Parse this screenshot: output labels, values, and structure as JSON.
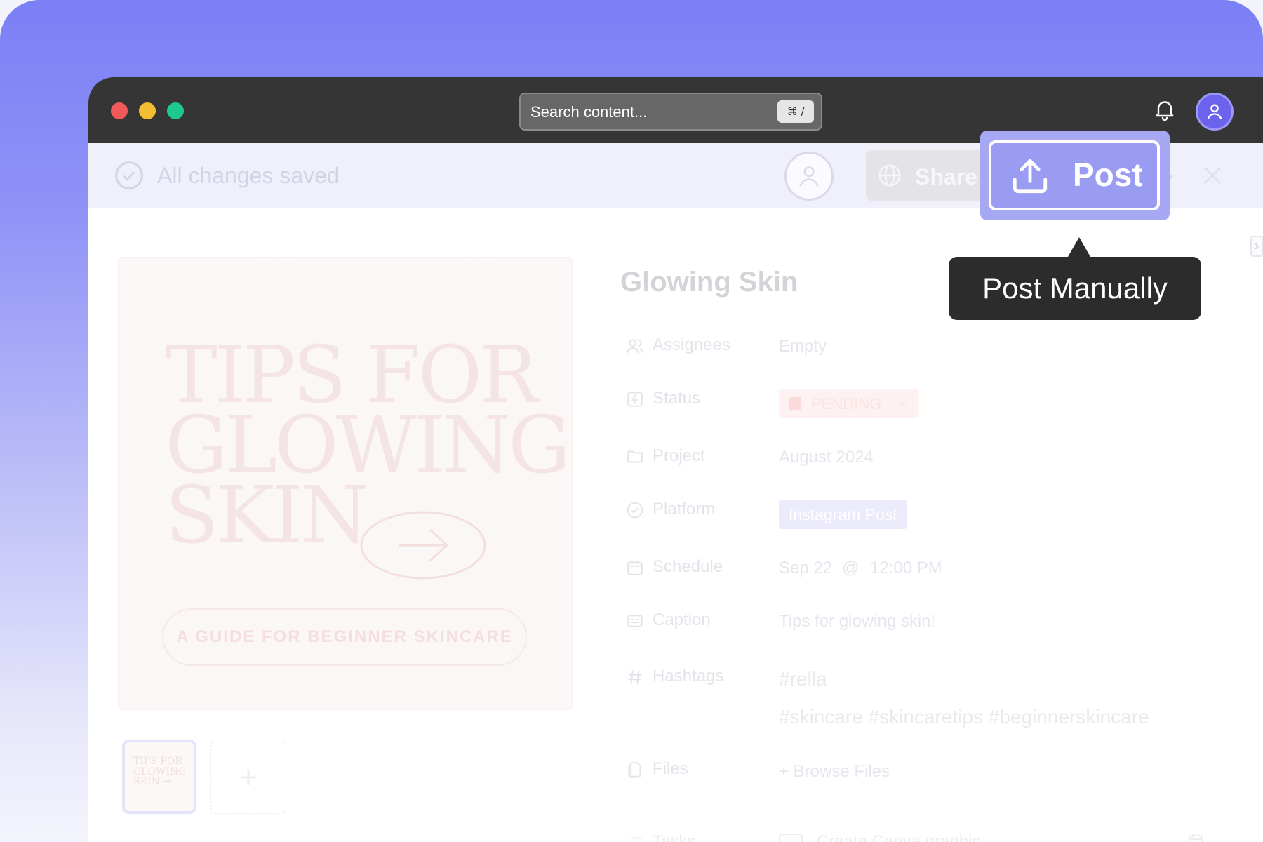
{
  "titlebar": {
    "search_placeholder": "Search content...",
    "search_shortcut": "⌘ /",
    "icons": [
      "bell-icon",
      "user-avatar-icon"
    ]
  },
  "toolbar": {
    "saved_status": "All changes saved",
    "share_label": "Share",
    "post_label": "Post",
    "tooltip": "Post Manually"
  },
  "preview": {
    "headline_lines": [
      "TIPS FOR",
      "GLOWING",
      "SKIN"
    ],
    "guide_text": "A GUIDE FOR BEGINNER SKINCARE",
    "thumb_lines": [
      "TIPS FOR",
      "GLOWING",
      "SKIN →"
    ],
    "add_symbol": "+"
  },
  "document": {
    "title": "Glowing Skin",
    "properties": {
      "assignees": {
        "label": "Assignees",
        "value": "Empty"
      },
      "status": {
        "label": "Status",
        "value": "PENDING"
      },
      "project": {
        "label": "Project",
        "value": "August 2024"
      },
      "platform": {
        "label": "Platform",
        "value": "Instagram Post"
      },
      "schedule": {
        "label": "Schedule",
        "date": "Sep 22",
        "at": "@",
        "time": "12:00 PM"
      },
      "caption": {
        "label": "Caption",
        "value": "Tips for glowing skin!"
      },
      "hashtags": {
        "label": "Hashtags",
        "line1": "#rella",
        "line2": "#skincare  #skincaretips  #beginnerskincare"
      },
      "files": {
        "label": "Files",
        "value": "+ Browse Files"
      },
      "tasks": {
        "label": "Tasks",
        "value": "Create Canva graphic"
      }
    }
  },
  "colors": {
    "accent": "#6b63ee",
    "titlebar": "#353535",
    "post_button": "#9a9cf2",
    "tooltip_bg": "#2c2c2c"
  }
}
